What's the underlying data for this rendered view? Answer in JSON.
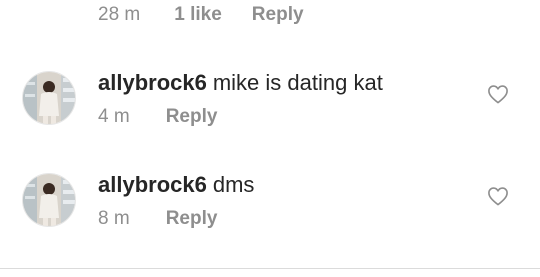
{
  "top_comment": {
    "time": "28 m",
    "likes": "1 like",
    "reply_label": "Reply"
  },
  "comments": [
    {
      "username": "allybrock6",
      "text": "mike is dating kat",
      "time": "4 m",
      "reply_label": "Reply"
    },
    {
      "username": "allybrock6",
      "text": "dms",
      "time": "8 m",
      "reply_label": "Reply"
    }
  ],
  "icons": {
    "like": "heart-outline-icon",
    "avatar": "user-avatar"
  },
  "colors": {
    "text_primary": "#262626",
    "text_secondary": "#8e8e8e"
  }
}
